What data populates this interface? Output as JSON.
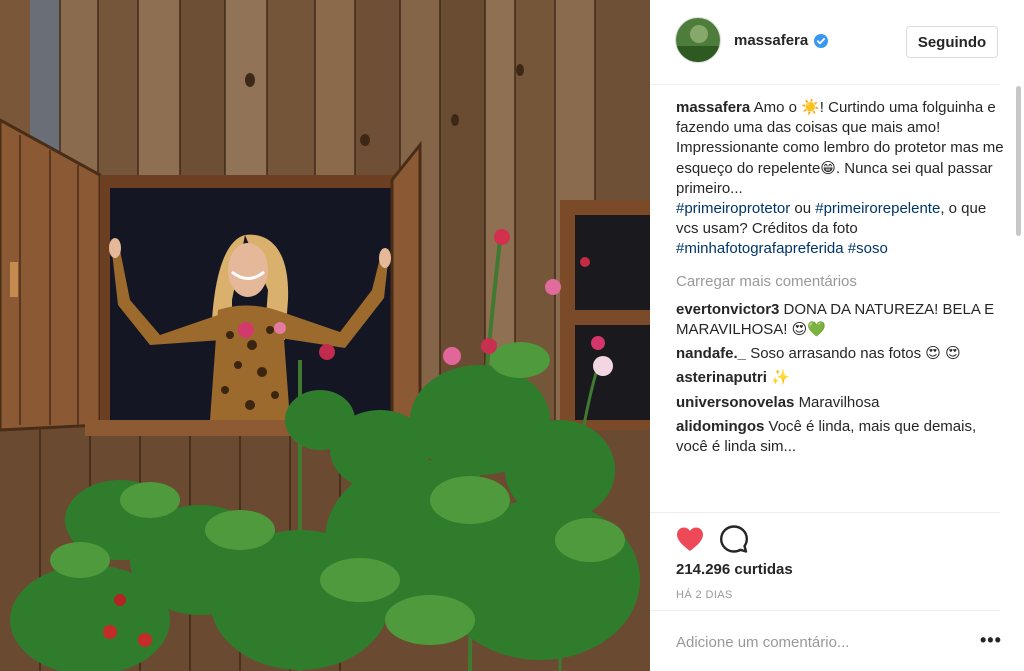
{
  "post": {
    "username": "massafera",
    "follow_label": "Seguindo",
    "caption": {
      "user": "massafera",
      "lines": [
        "Amo o ☀️! Curtindo uma folguinha e fazendo uma das coisas que mais amo!",
        "Impressionante como lembro do protetor mas me esqueço do repelente😁. Nunca sei qual passar primeiro..."
      ],
      "tag1": "#primeiroprotetor",
      "joiner": " ou ",
      "tag2": "#primeirorepelente",
      "tail": ", o que vcs usam? Créditos da foto",
      "tag3": "#minhafotografapreferida",
      "tag4": "#soso"
    },
    "load_more": "Carregar mais comentários",
    "comments": [
      {
        "user": "evertonvictor3",
        "text": "DONA DA NATUREZA! BELA E MARAVILHOSA! 😍💚"
      },
      {
        "user": "nandafe._",
        "text": "Soso arrasando nas fotos 😍 😍"
      },
      {
        "user": "asterinaputri",
        "text": "✨"
      },
      {
        "user": "universonovelas",
        "text": "Maravilhosa"
      },
      {
        "user": "alidomingos",
        "text": "Você é linda, mais que demais, você é linda sim..."
      }
    ],
    "likes": "214.296 curtidas",
    "timestamp": "HÁ 2 DIAS",
    "add_comment_placeholder": "Adicione um comentário...",
    "more_options": "•••"
  },
  "colors": {
    "like_red": "#ed4956",
    "verified_blue": "#3897f0",
    "hashtag_blue": "#003569"
  },
  "icons": {
    "like": "heart-filled-icon",
    "comment": "speech-bubble-icon",
    "verified": "verified-badge-icon",
    "more": "ellipsis-icon"
  }
}
